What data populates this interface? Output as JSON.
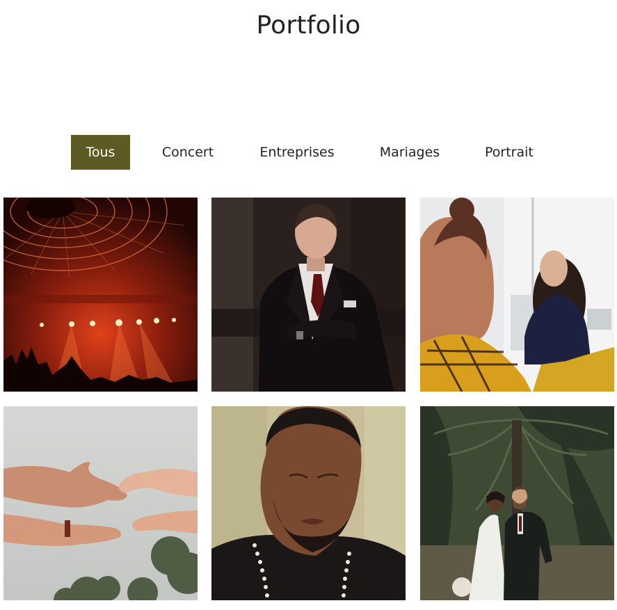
{
  "page": {
    "title": "Portfolio"
  },
  "filters": [
    {
      "label": "Tous",
      "active": true
    },
    {
      "label": "Concert",
      "active": false
    },
    {
      "label": "Entreprises",
      "active": false
    },
    {
      "label": "Mariages",
      "active": false
    },
    {
      "label": "Portrait",
      "active": false
    }
  ],
  "colors": {
    "accent": "#5e5a23",
    "text": "#222222",
    "background": "#ffffff"
  },
  "gallery": [
    {
      "subject": "concert-stage-photo"
    },
    {
      "subject": "businessman-portrait-photo"
    },
    {
      "subject": "office-meeting-photo"
    },
    {
      "subject": "wedding-hands-photo"
    },
    {
      "subject": "man-portrait-photo"
    },
    {
      "subject": "wedding-couple-photo"
    }
  ]
}
